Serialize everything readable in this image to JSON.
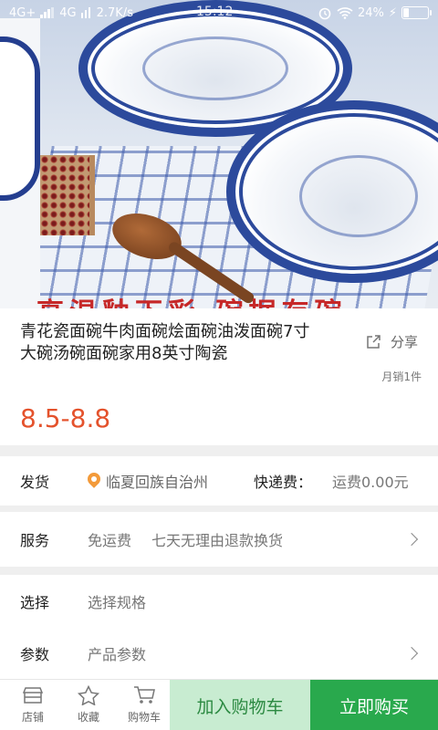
{
  "status_bar": {
    "network": "4G+",
    "network2": "4G",
    "speed": "2.7K/s",
    "time": "15:12",
    "battery": "24%",
    "battery_level": 0.24
  },
  "product": {
    "image_banner_text": "高温釉下彩 碗据存碗",
    "title": "青花瓷面碗牛肉面碗烩面碗油泼面碗7寸大碗汤碗面碗家用8英寸陶瓷",
    "share_label": "分享",
    "sales": "月销1件",
    "price": "8.5-8.8"
  },
  "shipping": {
    "label": "发货",
    "location": "临夏回族自治州",
    "fee_label": "快递费：",
    "fee_value": "运费0.00元"
  },
  "service": {
    "label": "服务",
    "tags": [
      "免运费",
      "七天无理由退款换货"
    ]
  },
  "select": {
    "label": "选择",
    "value": "选择规格"
  },
  "params": {
    "label": "参数",
    "value": "产品参数"
  },
  "bottom_bar": {
    "store": "店铺",
    "favorite": "收藏",
    "cart": "购物车",
    "add_to_cart": "加入购物车",
    "buy_now": "立即购买"
  },
  "colors": {
    "price": "#e4522c",
    "buy": "#29a94d",
    "add_cart_bg": "#c8ecd1",
    "add_cart_text": "#2c8a42"
  }
}
